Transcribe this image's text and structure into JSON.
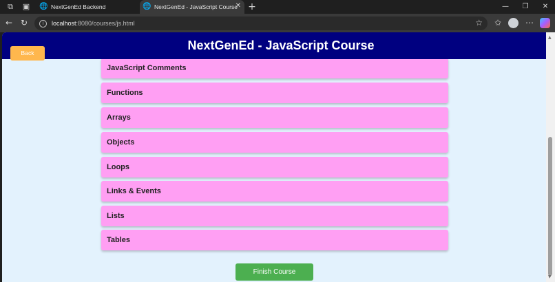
{
  "browser": {
    "tabs": [
      {
        "title": "NextGenEd Backend",
        "favicon": "globe-icon"
      },
      {
        "title": "NextGenEd - JavaScript Course",
        "favicon": "globe-icon"
      }
    ],
    "url": {
      "host": "localhost",
      "path": ":8080/courses/js.html"
    },
    "icons": [
      "workspaces-icon",
      "tab-actions-icon",
      "new-tab-icon",
      "minimize-icon",
      "maximize-icon",
      "close-window-icon",
      "back-icon",
      "refresh-icon",
      "site-info-icon",
      "favorite-star-icon",
      "favorites-icon",
      "profile-avatar",
      "menu-icon",
      "copilot-icon"
    ]
  },
  "page": {
    "title": "NextGenEd - JavaScript Course",
    "back_label": "Back",
    "finish_label": "Finish Course",
    "accent_colors": {
      "header": "#000080",
      "topic": "#ff9ff3",
      "back": "#ffb74d",
      "finish": "#4caf50",
      "background": "#e3f2fd"
    }
  },
  "topics": [
    "JavaScript Comments",
    "Functions",
    "Arrays",
    "Objects",
    "Loops",
    "Links & Events",
    "Lists",
    "Tables"
  ]
}
